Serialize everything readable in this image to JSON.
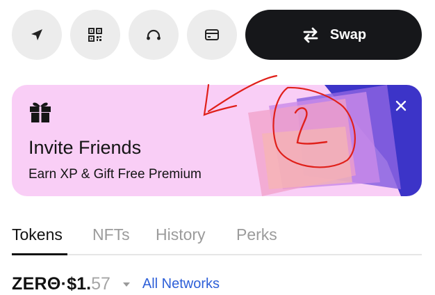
{
  "toolbar": {
    "buttons": [
      {
        "icon": "send-icon"
      },
      {
        "icon": "qr-code-icon"
      },
      {
        "icon": "headphones-icon"
      },
      {
        "icon": "card-icon"
      }
    ],
    "swap_label": "Swap"
  },
  "banner": {
    "title": "Invite Friends",
    "subtitle": "Earn XP & Gift Free Premium",
    "background": "#f9cef6"
  },
  "tabs": [
    {
      "label": "Tokens",
      "active": true
    },
    {
      "label": "NFTs",
      "active": false
    },
    {
      "label": "History",
      "active": false
    },
    {
      "label": "Perks",
      "active": false
    }
  ],
  "balance": {
    "token": "ZERΘ",
    "separator": " · ",
    "price_main": "$1.",
    "price_dim": "57",
    "networks_label": "All Networks"
  },
  "colors": {
    "accent_link": "#2d5fd8",
    "swap_bg": "#16171a",
    "round_btn_bg": "#ececec"
  }
}
